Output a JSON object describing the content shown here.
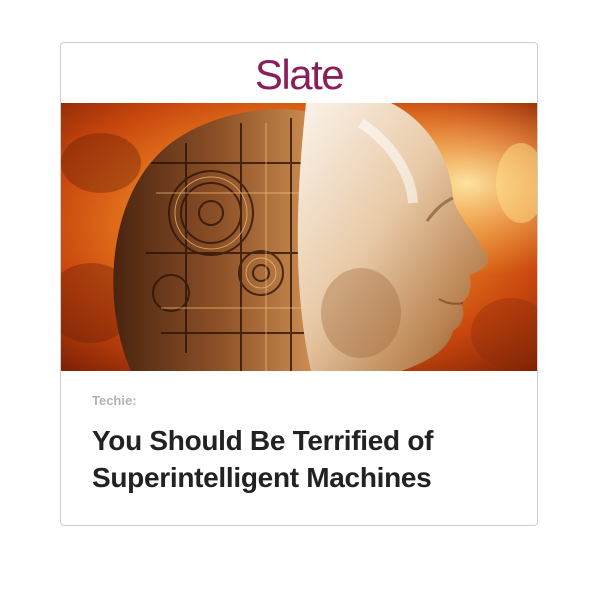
{
  "card": {
    "brand": "Slate",
    "brand_color": "#8a1e5b",
    "image_icon": "robot-head-in-flames-image",
    "kicker": "Techie:",
    "headline": "You Should Be Terrified of Superintelligent Machines"
  }
}
